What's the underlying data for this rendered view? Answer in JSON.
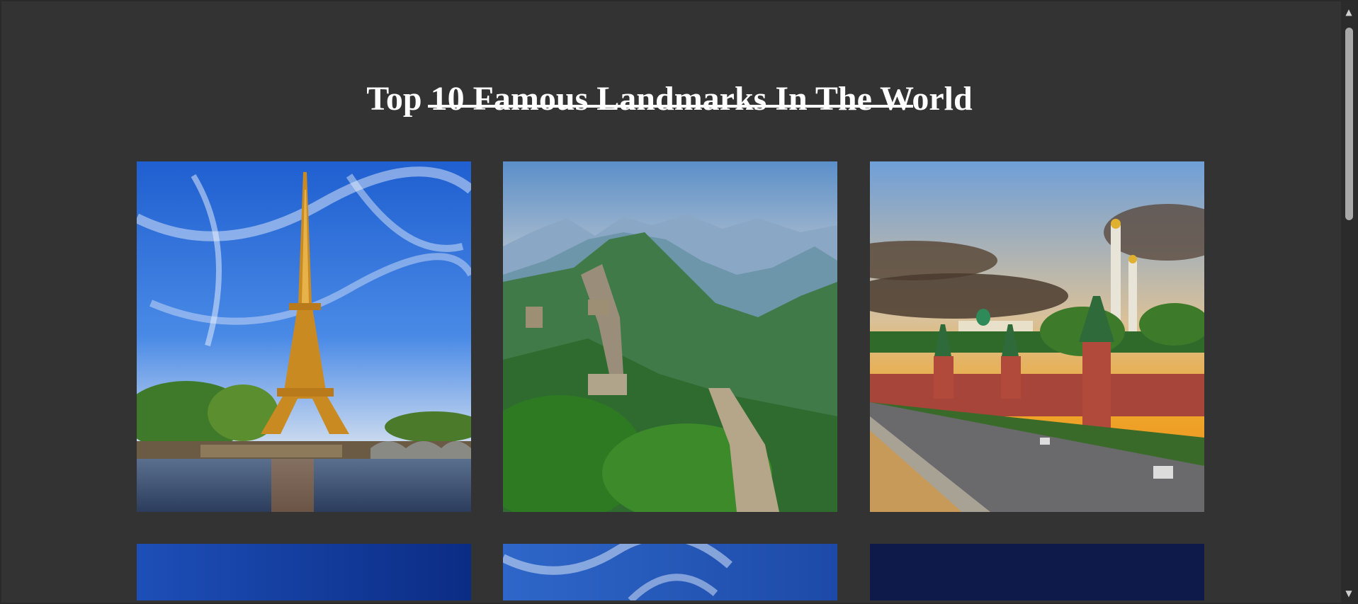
{
  "page": {
    "title": "Top 10 Famous Landmarks In The World"
  },
  "gallery": {
    "items": [
      {
        "icon": "eiffel-tower-image"
      },
      {
        "icon": "great-wall-image"
      },
      {
        "icon": "kremlin-image"
      },
      {
        "icon": "blue-sky-image"
      },
      {
        "icon": "cloudy-sky-image"
      },
      {
        "icon": "night-sky-image"
      }
    ]
  },
  "scrollbar": {
    "up_glyph": "▲",
    "down_glyph": "▼"
  },
  "colors": {
    "background": "#333333",
    "title": "#ffffff"
  }
}
